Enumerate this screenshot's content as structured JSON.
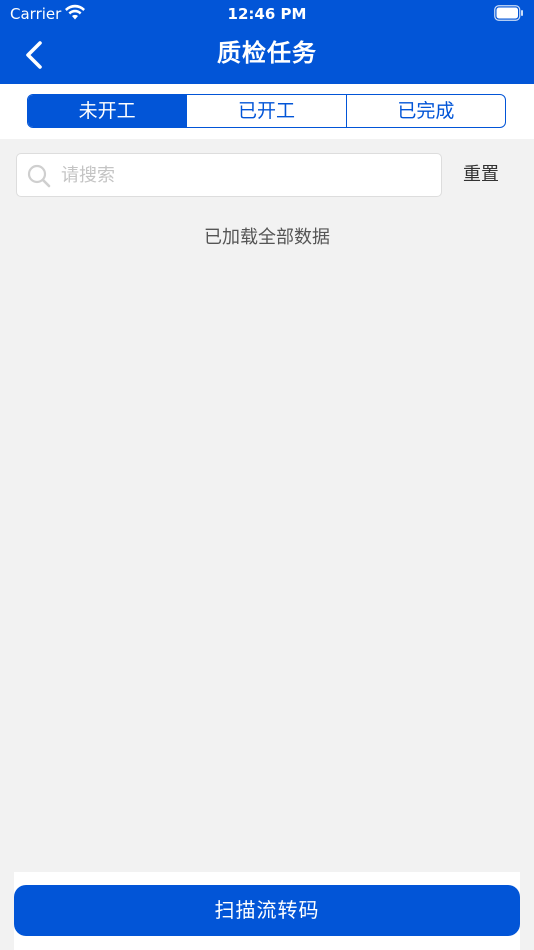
{
  "status_bar": {
    "carrier": "Carrier",
    "time": "12:46 PM"
  },
  "nav": {
    "title": "质检任务",
    "back_icon": "chevron-left-icon"
  },
  "tabs": [
    {
      "label": "未开工",
      "active": true
    },
    {
      "label": "已开工",
      "active": false
    },
    {
      "label": "已完成",
      "active": false
    }
  ],
  "search": {
    "placeholder": "请搜索",
    "value": "",
    "icon": "search-icon",
    "reset_label": "重置"
  },
  "list": {
    "status_text": "已加载全部数据"
  },
  "footer": {
    "scan_label": "扫描流转码"
  },
  "colors": {
    "primary": "#0255D7",
    "background": "#f2f2f2"
  }
}
